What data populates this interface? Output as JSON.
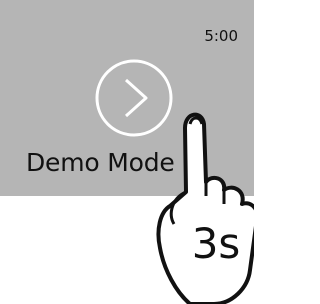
{
  "screen": {
    "clock": "5:00",
    "mode_label": "Demo Mode",
    "start_icon": "play-chevron-icon"
  },
  "gesture": {
    "icon": "hand-press-icon",
    "hold_duration": "3s"
  },
  "colors": {
    "screen_bg": "#b5b5b5",
    "text": "#111111",
    "icon_stroke": "#ffffff",
    "hand_stroke": "#111111"
  }
}
